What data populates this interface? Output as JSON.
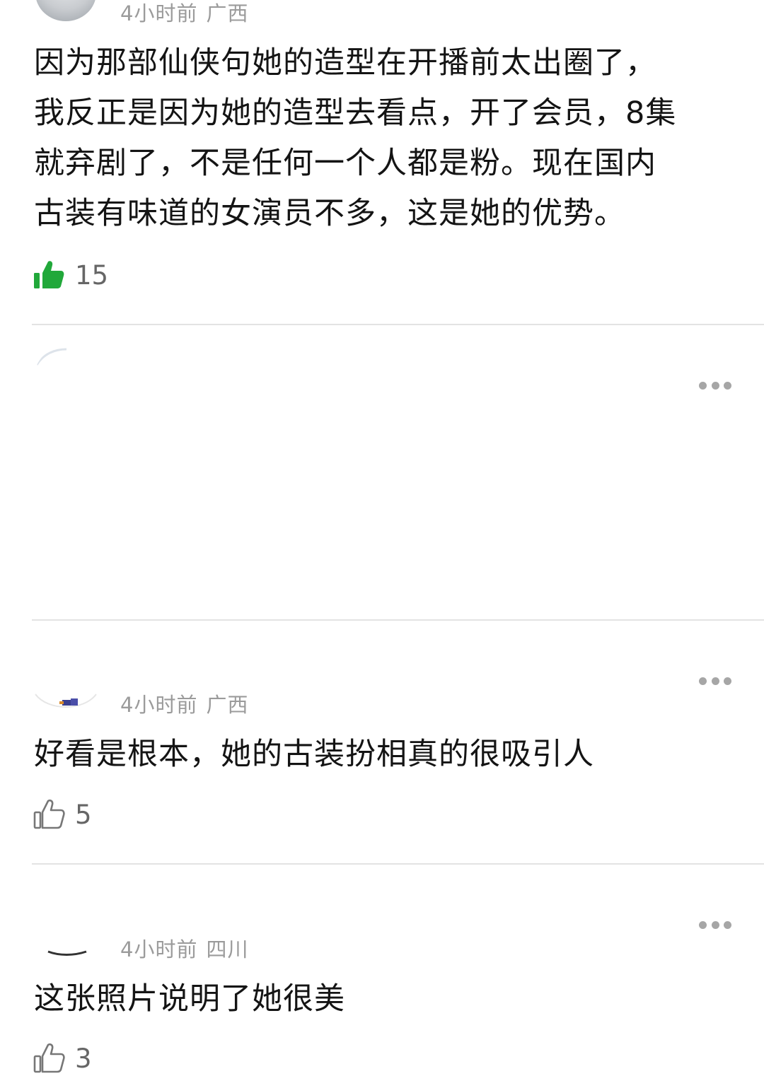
{
  "comments": [
    {
      "time": "4小时前",
      "location": "广西",
      "text_lines": [
        "因为那部仙侠句她的造型在开播前太出圈了，",
        "我反正是因为她的造型去看点，开了会员，8集",
        "就弃剧了，不是任何一个人都是粉。现在国内",
        "古装有味道的女演员不多，这是她的优势。"
      ],
      "likes": "15",
      "liked": true,
      "like_icon": "thumbs-up-filled-icon"
    },
    {
      "more_icon": "more-options-icon"
    },
    {
      "time": "4小时前",
      "location": "广西",
      "text": "好看是根本，她的古装扮相真的很吸引人",
      "likes": "5",
      "liked": false,
      "like_icon": "thumbs-up-outline-icon",
      "more_icon": "more-options-icon"
    },
    {
      "time": "4小时前",
      "location": "四川",
      "text": "这张照片说明了她很美",
      "likes": "3",
      "liked": false,
      "like_icon": "thumbs-up-outline-icon",
      "more_icon": "more-options-icon"
    }
  ],
  "colors": {
    "liked_green": "#21a83a",
    "meta_gray": "#9b9b9b",
    "divider": "#e3e3e3"
  }
}
